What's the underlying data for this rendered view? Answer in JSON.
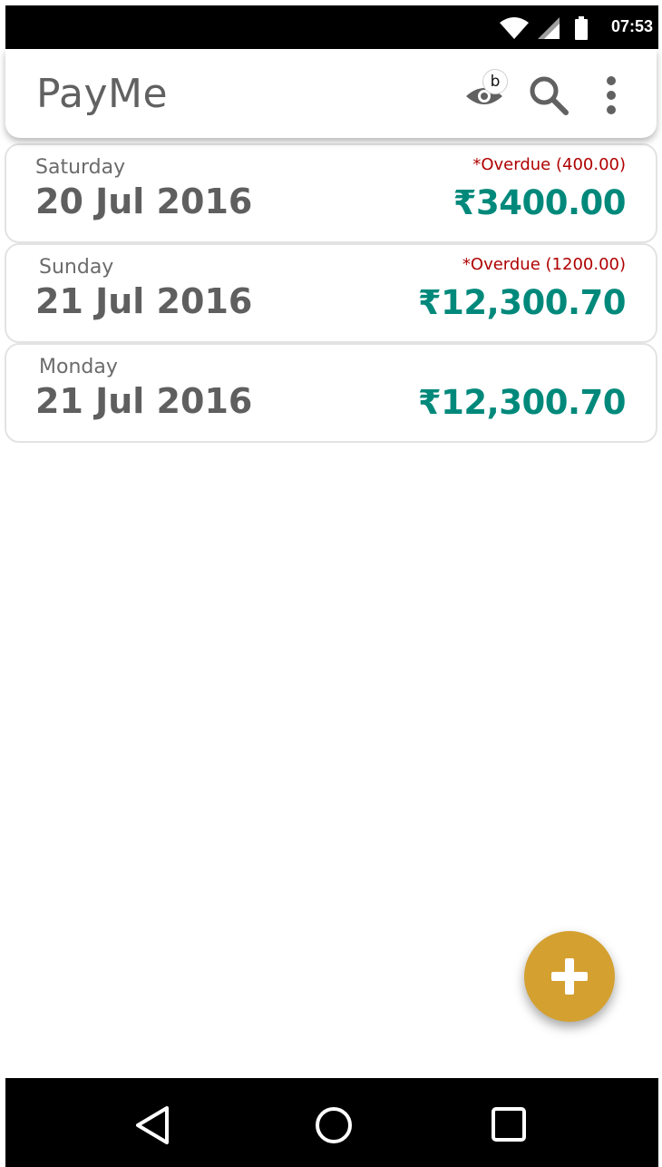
{
  "status_bar": {
    "time": "07:53",
    "icons": [
      "wifi-icon",
      "cell-signal-icon",
      "battery-icon"
    ]
  },
  "app_bar": {
    "title": "PayMe",
    "badge": "b",
    "actions": [
      "eye-icon",
      "search-icon",
      "more-vert-icon"
    ]
  },
  "entries": [
    {
      "day": "Saturday",
      "date": "20 Jul 2016",
      "overdue": "*Overdue (400.00)",
      "amount": "₹3400.00"
    },
    {
      "day": "Sunday",
      "date": "21 Jul 2016",
      "overdue": "*Overdue (1200.00)",
      "amount": "₹12,300.70"
    },
    {
      "day": "Monday",
      "date": "21 Jul 2016",
      "overdue": "",
      "amount": "₹12,300.70"
    }
  ],
  "fab": {
    "icon": "plus-icon",
    "color": "#d4a030"
  },
  "colors": {
    "amount": "#00897b",
    "overdue": "#b00000",
    "title": "#616161"
  },
  "nav_bar": {
    "icons": [
      "back-icon",
      "home-icon",
      "recents-icon"
    ]
  }
}
